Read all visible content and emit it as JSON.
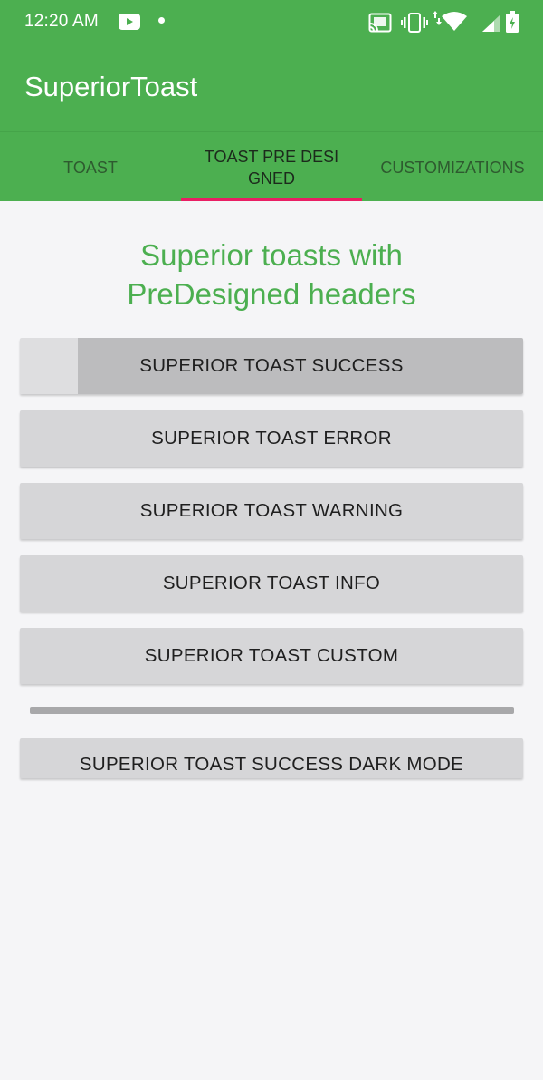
{
  "status_bar": {
    "time": "12:20 AM",
    "icons": [
      "youtube-icon",
      "notification-dot-icon",
      "cast-icon",
      "vibrate-icon",
      "data-arrows-icon",
      "wifi-icon",
      "signal-icon",
      "battery-icon"
    ]
  },
  "app_bar": {
    "title": "SuperiorToast"
  },
  "tabs": [
    {
      "label": "TOAST",
      "active": false
    },
    {
      "label": "TOAST PRE DESIGNED",
      "active": true
    },
    {
      "label": "CUSTOMIZATIONS",
      "active": false
    }
  ],
  "main": {
    "heading": "Superior toasts with PreDesigned headers",
    "buttons": [
      {
        "label": "SUPERIOR TOAST SUCCESS"
      },
      {
        "label": "SUPERIOR TOAST ERROR"
      },
      {
        "label": "SUPERIOR TOAST WARNING"
      },
      {
        "label": "SUPERIOR TOAST INFO"
      },
      {
        "label": "SUPERIOR TOAST CUSTOM"
      },
      {
        "label": "SUPERIOR TOAST SUCCESS DARK MODE"
      }
    ]
  },
  "colors": {
    "primary": "#4caf50",
    "tab_indicator": "#e91e63",
    "background": "#f5f5f7",
    "button": "#d6d6d8"
  }
}
